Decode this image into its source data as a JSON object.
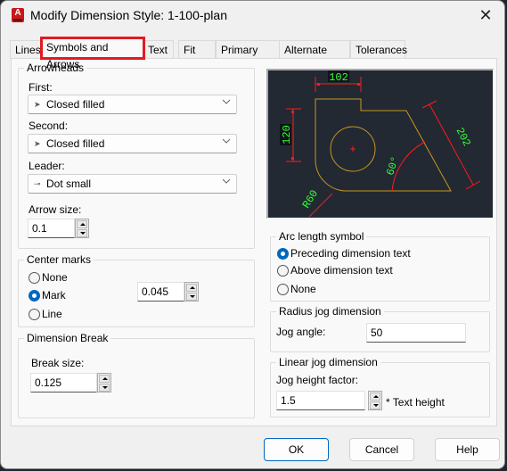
{
  "window": {
    "title": "Modify Dimension Style: 1-100-plan",
    "app_icon": "autocad-icon",
    "close_icon": "close-icon"
  },
  "tabs": [
    {
      "label": "Lines",
      "active": false
    },
    {
      "label": "Symbols and Arrows",
      "active": true
    },
    {
      "label": "Text",
      "active": false
    },
    {
      "label": "Fit",
      "active": false
    },
    {
      "label": "Primary Units",
      "active": false
    },
    {
      "label": "Alternate Units",
      "active": false
    },
    {
      "label": "Tolerances",
      "active": false
    }
  ],
  "arrowheads": {
    "group_label": "Arrowheads",
    "first_label": "First:",
    "first_value": "Closed filled",
    "second_label": "Second:",
    "second_value": "Closed filled",
    "leader_label": "Leader:",
    "leader_value": "Dot small",
    "arrow_size_label": "Arrow size:",
    "arrow_size_value": "0.1"
  },
  "center_marks": {
    "group_label": "Center marks",
    "options": [
      {
        "label": "None",
        "checked": false
      },
      {
        "label": "Mark",
        "checked": true
      },
      {
        "label": "Line",
        "checked": false
      }
    ],
    "size_value": "0.045"
  },
  "dimension_break": {
    "group_label": "Dimension Break",
    "break_size_label": "Break size:",
    "break_size_value": "0.125"
  },
  "preview": {
    "dims": {
      "top": "102",
      "left": "120",
      "right": "202",
      "angle": "60°",
      "radius": "R60"
    },
    "colors": {
      "background": "#222933",
      "geometry": "#c8961e",
      "dimension": "#ff1a1a",
      "text": "#33ff33"
    }
  },
  "arc_length_symbol": {
    "group_label": "Arc length symbol",
    "options": [
      {
        "label": "Preceding dimension text",
        "checked": true
      },
      {
        "label": "Above dimension text",
        "checked": false
      },
      {
        "label": "None",
        "checked": false
      }
    ]
  },
  "radius_jog": {
    "group_label": "Radius jog dimension",
    "jog_angle_label": "Jog angle:",
    "jog_angle_value": "50"
  },
  "linear_jog": {
    "group_label": "Linear jog dimension",
    "factor_label": "Jog height factor:",
    "factor_value": "1.5",
    "suffix": "* Text height"
  },
  "buttons": {
    "ok": "OK",
    "cancel": "Cancel",
    "help": "Help"
  },
  "accent_color": "#0067c0",
  "highlight_color": "#e01b24"
}
